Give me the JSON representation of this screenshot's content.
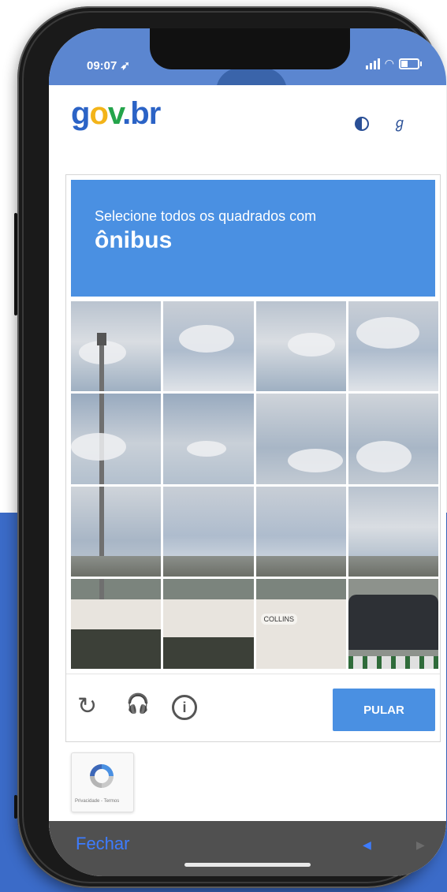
{
  "status_bar": {
    "time": "09:07 ",
    "location_glyph": "➶"
  },
  "header": {
    "logo_parts": [
      "g",
      "o",
      "v",
      ".",
      "br"
    ],
    "contrast_icon": "contrast-icon",
    "accessibility_icon": "hand-sign-icon",
    "accessibility_glyph": "ℊ"
  },
  "captcha": {
    "prompt": "Selecione todos os quadrados com",
    "object": "ônibus",
    "skip_label": "PULAR",
    "reload_glyph": "↻",
    "audio_glyph": "🎧",
    "info_glyph": "i",
    "sign_text": "COLLINS"
  },
  "recaptcha_badge": {
    "text": "Privacidade - Termos"
  },
  "bottom_bar": {
    "close_label": "Fechar",
    "prev_glyph": "◀",
    "next_glyph": "▶"
  },
  "colors": {
    "header_blue": "#4a90e2",
    "logo_blue": "#2b63c6",
    "logo_yellow": "#f3b419",
    "logo_green": "#24a44b",
    "link_blue": "#3d7cff"
  }
}
